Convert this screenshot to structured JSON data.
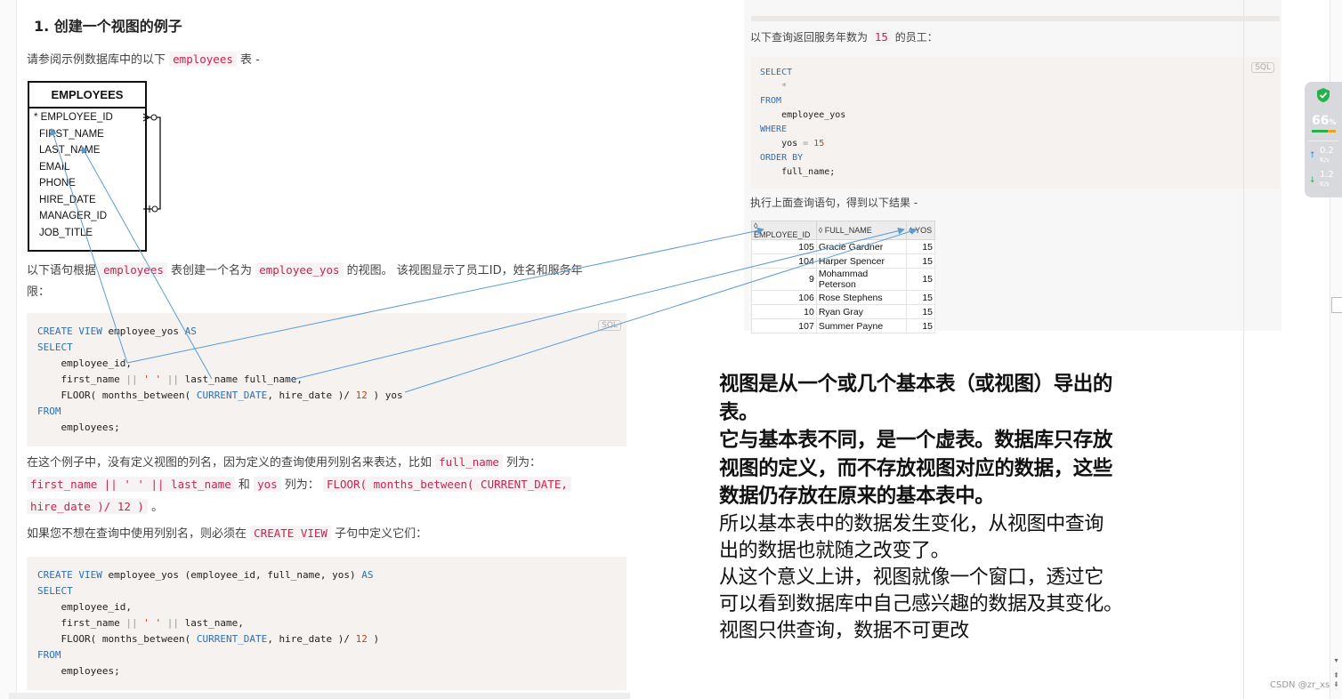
{
  "left": {
    "heading": "1. 创建一个视图的例子",
    "intro_pre": "请参阅示例数据库中的以下",
    "intro_code": "employees",
    "intro_post": "表 -",
    "er": {
      "title": "EMPLOYEES",
      "rows": [
        "* EMPLOYEE_ID",
        "FIRST_NAME",
        "LAST_NAME",
        "EMAIL",
        "PHONE",
        "HIRE_DATE",
        "MANAGER_ID",
        "JOB_TITLE"
      ]
    },
    "para2_a": "以下语句根据",
    "para2_code1": "employees",
    "para2_b": "表创建一个名为",
    "para2_code2": "employee_yos",
    "para2_c": "的视图。 该视图显示了员工ID，姓名和服务年",
    "para2_d": "限：",
    "sql_tag": "SQL",
    "code1": {
      "l1_kw1": "CREATE VIEW",
      "l1_t": " employee_yos ",
      "l1_kw2": "AS",
      "l2": "SELECT",
      "l3": "    employee_id",
      "l4_a": "    first_name ",
      "l4_op1": "||",
      "l4_str": " ' ' ",
      "l4_op2": "||",
      "l4_b": " last_name full_name",
      "l5_a": "    FLOOR",
      "l5_b": "( months_between",
      "l5_c": "( ",
      "l5_kw": "CURRENT_DATE",
      "l5_d": ", hire_date ",
      "l5_e": ")/ ",
      "l5_num": "12",
      "l5_f": " ) yos",
      "l6": "FROM",
      "l7": "    employees;"
    },
    "para3_a": "在这个例子中，没有定义视图的列名，因为定义的查询使用列别名来表达，比如",
    "para3_code1": "full_name",
    "para3_b": "列为：",
    "para3_code2": "first_name || ' ' || last_name",
    "para3_c": "和",
    "para3_code3": "yos",
    "para3_d": "列为：",
    "para3_code4": "FLOOR( months_between( CURRENT_DATE,",
    "para3_code5": "hire_date )/ 12 )",
    "para3_e": "。",
    "para4_a": "如果您不想在查询中使用列别名，则必须在",
    "para4_code": "CREATE VIEW",
    "para4_b": "子句中定义它们：",
    "code2": {
      "l1_kw1": "CREATE VIEW",
      "l1_t": " employee_yos (employee_id, full_name, yos) ",
      "l1_kw2": "AS",
      "l2": "SELECT",
      "l3": "    employee_id,",
      "l4_a": "    first_name ",
      "l4_op1": "||",
      "l4_str": " ' ' ",
      "l4_op2": "||",
      "l4_b": " last_name,",
      "l5_a": "    FLOOR",
      "l5_b": "( months_between",
      "l5_c": "( ",
      "l5_kw": "CURRENT_DATE",
      "l5_d": ", hire_date ",
      "l5_e": ")/ ",
      "l5_num": "12",
      "l5_f": " )",
      "l6": "FROM",
      "l7": "    employees;"
    }
  },
  "right": {
    "q_pre": "以下查询返回服务年数为",
    "q_code": "15",
    "q_post": "的员工：",
    "sql_tag": "SQL",
    "code": {
      "l1": "SELECT",
      "l2": "    *",
      "l3": "FROM",
      "l4": "    employee_yos",
      "l5": "WHERE",
      "l6_a": "    yos ",
      "l6_op": "=",
      "l6_num": " 15",
      "l7": "ORDER BY",
      "l8": "    full_name;"
    },
    "result_label": "执行上面查询语句，得到以下结果 -",
    "table": {
      "headers": [
        "EMPLOYEE_ID",
        "FULL_NAME",
        "YOS"
      ],
      "rows": [
        [
          "105",
          "Gracie Gardner",
          "15"
        ],
        [
          "104",
          "Harper Spencer",
          "15"
        ],
        [
          "9",
          "Mohammad Peterson",
          "15"
        ],
        [
          "106",
          "Rose Stephens",
          "15"
        ],
        [
          "10",
          "Ryan Gray",
          "15"
        ],
        [
          "107",
          "Summer Payne",
          "15"
        ]
      ]
    }
  },
  "note": {
    "b1": "视图是从一个或几个基本表（或视图）导出的",
    "b2": "表。",
    "b3": "它与基本表不同，是一个虚表。数据库只存放",
    "b4": "视图的定义，而不存放视图对应的数据，这些",
    "b5": "数据仍存放在原来的基本表中。",
    "n1": "所以基本表中的数据发生变化，从视图中查询",
    "n2": "出的数据也就随之改变了。",
    "n3": "从这个意义上讲，视图就像一个窗口，透过它",
    "n4": "可以看到数据库中自己感兴趣的数据及其变化。",
    "n5": "视图只供查询，数据不可更改"
  },
  "widget": {
    "percent": "66",
    "percent_unit": "%",
    "up": "0.2",
    "down": "1.2",
    "unit": "K/s"
  },
  "watermark": "CSDN @zr_xs",
  "colors": {
    "arrow": "#5b9bd5",
    "keyword": "#2d6fb3",
    "inline_code": "#c7254e",
    "shield": "#27b04b"
  }
}
